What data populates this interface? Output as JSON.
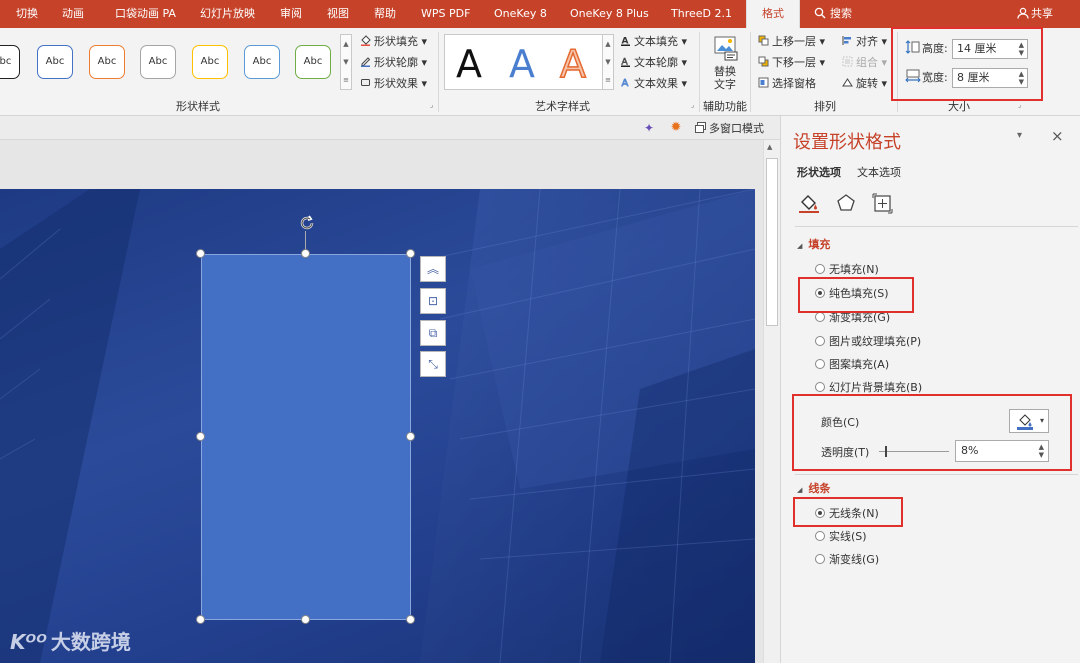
{
  "tabs": [
    "切换",
    "动画",
    "口袋动画 PA",
    "幻灯片放映",
    "审阅",
    "视图",
    "帮助",
    "WPS PDF",
    "OneKey 8",
    "OneKey 8 Plus",
    "ThreeD 2.1",
    "格式"
  ],
  "tabbar": {
    "search": "搜索",
    "share": "共享"
  },
  "ribbon": {
    "shape_style_label": "Abc",
    "shape_style_colors": [
      "#222222",
      "#4472c4",
      "#ed7d31",
      "#a5a5a5",
      "#ffc000",
      "#5b9bd5",
      "#70ad47"
    ],
    "shape_cmds": [
      "形状填充",
      "形状轮廓",
      "形状效果"
    ],
    "shape_group": "形状样式",
    "wordart_letter": "A",
    "text_cmds": [
      "文本填充",
      "文本轮廓",
      "文本效果"
    ],
    "wordart_group": "艺术字样式",
    "replace_text": [
      "替换",
      "文字"
    ],
    "assist_group": "辅助功能",
    "arrange_cmds": [
      "上移一层",
      "下移一层",
      "选择窗格"
    ],
    "align_cmds": [
      "对齐",
      "组合",
      "旋转"
    ],
    "arrange_group": "排列",
    "height_label": "高度:",
    "height_value": "14 厘米",
    "width_label": "宽度:",
    "width_value": "8 厘米",
    "size_group": "大小"
  },
  "quickbar": {
    "multiwindow": "多窗口模式"
  },
  "pane": {
    "title": "设置形状格式",
    "tab_shape": "形状选项",
    "tab_text": "文本选项",
    "fill_header": "填充",
    "fill_options": [
      "无填充(N)",
      "纯色填充(S)",
      "渐变填充(G)",
      "图片或纹理填充(P)",
      "图案填充(A)",
      "幻灯片背景填充(B)"
    ],
    "fill_selected": 1,
    "color_label": "颜色(C)",
    "transparency_label": "透明度(T)",
    "transparency_value": "8%",
    "transparency": 0.08,
    "line_header": "线条",
    "line_options": [
      "无线条(N)",
      "实线(S)",
      "渐变线(G)"
    ],
    "line_selected": 0
  },
  "watermark": "大数跨境",
  "colors": {
    "accent": "#c6432a",
    "shape": "#4370c4",
    "highlight": "#e0302c"
  }
}
